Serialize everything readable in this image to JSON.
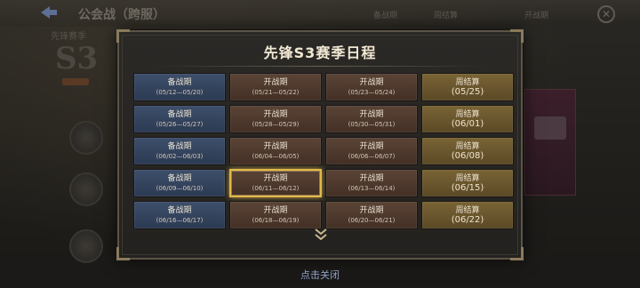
{
  "background": {
    "title": "公会战（跨服）",
    "tabs": [
      "备战期",
      "周结算",
      "开战期"
    ],
    "season_label": "先锋赛季",
    "season_code": "S3"
  },
  "modal": {
    "title": "先锋S3赛季日程",
    "rows": [
      [
        {
          "name": "备战期",
          "date": "(05/12—05/20)",
          "type": "prep"
        },
        {
          "name": "开战期",
          "date": "(05/21—05/22)",
          "type": "battle"
        },
        {
          "name": "开战期",
          "date": "(05/23—05/24)",
          "type": "battle"
        },
        {
          "name": "周结算",
          "date": "(05/25)",
          "type": "settle"
        }
      ],
      [
        {
          "name": "备战期",
          "date": "(05/26—05/27)",
          "type": "prep"
        },
        {
          "name": "开战期",
          "date": "(05/28—05/29)",
          "type": "battle"
        },
        {
          "name": "开战期",
          "date": "(05/30—05/31)",
          "type": "battle"
        },
        {
          "name": "周结算",
          "date": "(06/01)",
          "type": "settle"
        }
      ],
      [
        {
          "name": "备战期",
          "date": "(06/02—06/03)",
          "type": "prep"
        },
        {
          "name": "开战期",
          "date": "(06/04—06/05)",
          "type": "battle"
        },
        {
          "name": "开战期",
          "date": "(06/06—06/07)",
          "type": "battle"
        },
        {
          "name": "周结算",
          "date": "(06/08)",
          "type": "settle"
        }
      ],
      [
        {
          "name": "备战期",
          "date": "(06/09—06/10)",
          "type": "prep"
        },
        {
          "name": "开战期",
          "date": "(06/11—06/12)",
          "type": "battle",
          "current": true
        },
        {
          "name": "开战期",
          "date": "(06/13—06/14)",
          "type": "battle"
        },
        {
          "name": "周结算",
          "date": "(06/15)",
          "type": "settle"
        }
      ],
      [
        {
          "name": "备战期",
          "date": "(06/16—06/17)",
          "type": "prep"
        },
        {
          "name": "开战期",
          "date": "(06/18—06/19)",
          "type": "battle"
        },
        {
          "name": "开战期",
          "date": "(06/20—06/21)",
          "type": "battle"
        },
        {
          "name": "周结算",
          "date": "(06/22)",
          "type": "settle"
        }
      ]
    ],
    "scroll_icon": "double-chevron-down-icon"
  },
  "close_hint": "点击关闭",
  "colors": {
    "prep": "#34455f",
    "battle": "#4e3a2d",
    "settle": "#6b572e",
    "highlight": "#e2b84a",
    "hint": "#8fa2c9"
  }
}
